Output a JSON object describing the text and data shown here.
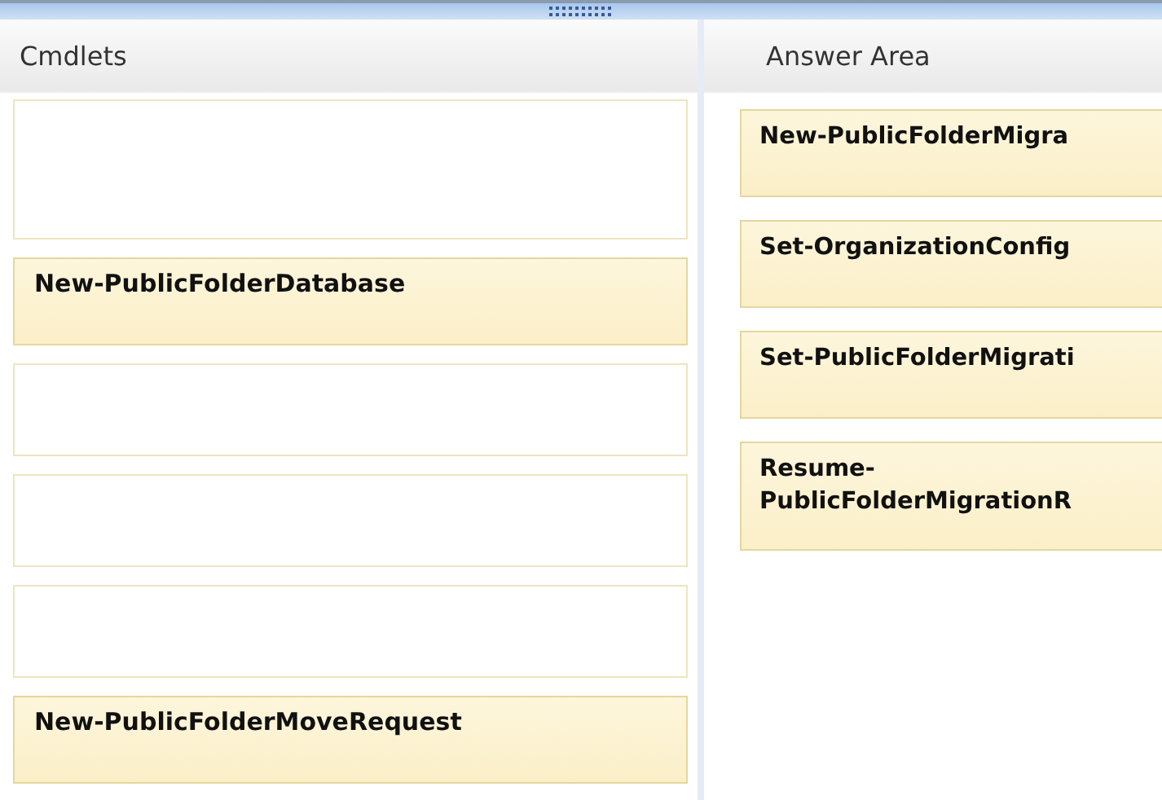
{
  "cmdlets": {
    "title": "Cmdlets",
    "slots": [
      {
        "kind": "empty"
      },
      {
        "kind": "cmdlet",
        "label": "New-PublicFolderDatabase"
      },
      {
        "kind": "empty"
      },
      {
        "kind": "empty"
      },
      {
        "kind": "empty"
      },
      {
        "kind": "cmdlet",
        "label": "New-PublicFolderMoveRequest"
      }
    ]
  },
  "answer_area": {
    "title": "Answer Area",
    "items": [
      {
        "label": "New-PublicFolderMigra"
      },
      {
        "label": "Set-OrganizationConfig"
      },
      {
        "label": "Set-PublicFolderMigrati"
      },
      {
        "label": "Resume-\nPublicFolderMigrationR"
      }
    ]
  }
}
